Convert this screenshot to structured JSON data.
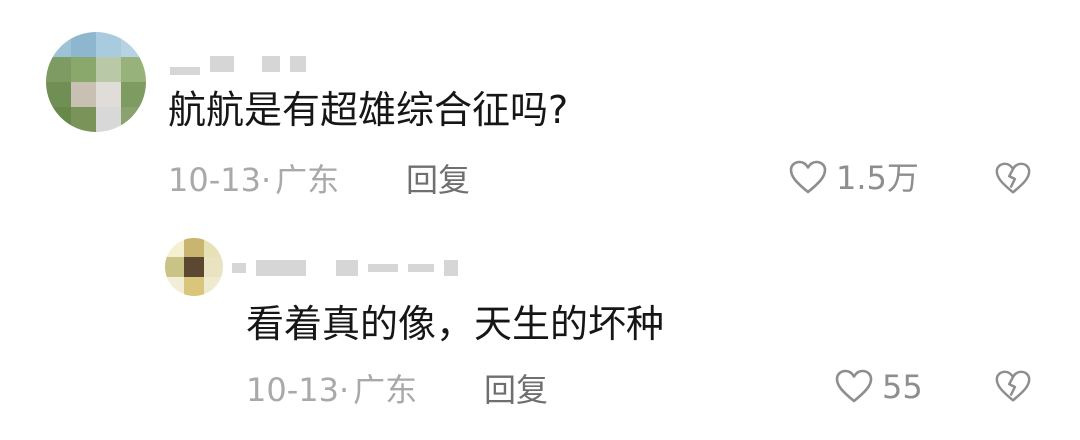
{
  "comment": {
    "text": "航航是有超雄综合征吗?",
    "date": "10-13",
    "separator": "·",
    "location": "广东",
    "reply_label": "回复",
    "like_count": "1.5万"
  },
  "reply": {
    "text": "看着真的像，天生的坏种",
    "date": "10-13",
    "separator": "·",
    "location": "广东",
    "reply_label": "回复",
    "like_count": "55"
  },
  "icons": {
    "like": "heart-outline-icon",
    "dislike": "broken-heart-icon"
  },
  "colors": {
    "text": "#161616",
    "meta": "#a9a9a9",
    "reply": "#6f6f6f",
    "icon": "#8e8e8e"
  }
}
